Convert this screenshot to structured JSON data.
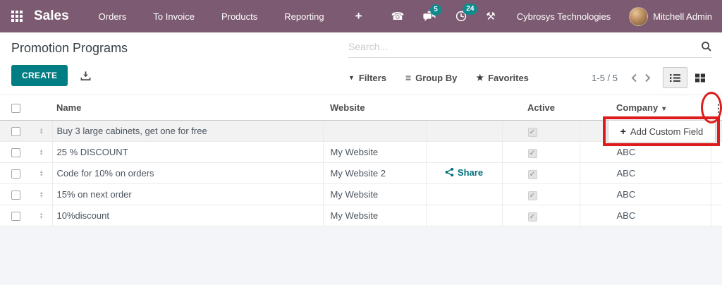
{
  "nav": {
    "app_name": "Sales",
    "menus": [
      "Orders",
      "To Invoice",
      "Products",
      "Reporting"
    ],
    "company": "Cybrosys Technologies",
    "user": "Mitchell Admin",
    "message_badge": "5",
    "activity_badge": "24"
  },
  "page": {
    "title": "Promotion Programs",
    "create_label": "CREATE"
  },
  "search": {
    "placeholder": "Search..."
  },
  "filters_bar": {
    "filters": "Filters",
    "group_by": "Group By",
    "favorites": "Favorites"
  },
  "pager": {
    "range": "1-5 / 5"
  },
  "table": {
    "columns": {
      "name": "Name",
      "website": "Website",
      "active": "Active",
      "company": "Company"
    },
    "rows": [
      {
        "name": "Buy 3 large cabinets, get one for free",
        "website": "",
        "share": "",
        "active": true,
        "company": ""
      },
      {
        "name": "25 % DISCOUNT",
        "website": "My Website",
        "share": "",
        "active": true,
        "company": "ABC"
      },
      {
        "name": "Code for 10% on orders",
        "website": "My Website 2",
        "share": "Share",
        "active": true,
        "company": "ABC"
      },
      {
        "name": "15% on next order",
        "website": "My Website",
        "share": "",
        "active": true,
        "company": "ABC"
      },
      {
        "name": "10%discount",
        "website": "My Website",
        "share": "",
        "active": true,
        "company": "ABC"
      }
    ]
  },
  "dropdown": {
    "add_custom_field": "Add Custom Field",
    "plus": "+"
  },
  "icons": {
    "plus_menu": "+",
    "dots_vertical": "⋮",
    "sort_caret": "▾",
    "filter_caret": "▼",
    "group_glyph": "≡",
    "star_glyph": "★",
    "phone_glyph": "☎",
    "tools_glyph": "⚒",
    "handle_up": "▲",
    "handle_down": "▼",
    "check": "✓"
  },
  "colors": {
    "navbar": "#7c5a71",
    "accent_teal": "#017e84",
    "badge_teal": "#0f8a8d",
    "annotation_red": "#dd1d1d"
  }
}
